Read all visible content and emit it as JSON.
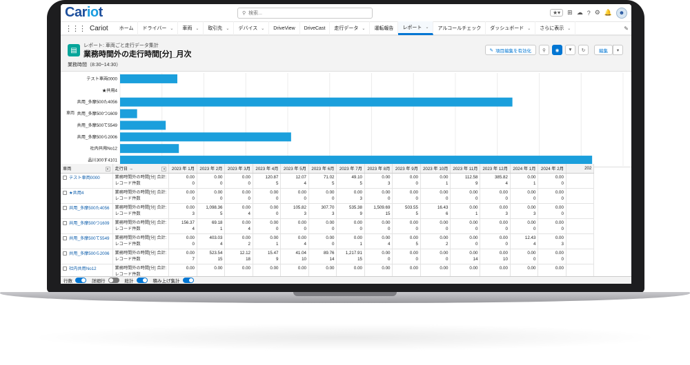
{
  "app": {
    "logo_prefix": "Car",
    "logo_o": "io",
    "logo_suffix": "t",
    "app_name": "Cariot",
    "search_placeholder": "検索..."
  },
  "nav": [
    {
      "label": "ホーム",
      "dropdown": false,
      "active": false
    },
    {
      "label": "ドライバー",
      "dropdown": true,
      "active": false
    },
    {
      "label": "車両",
      "dropdown": true,
      "active": false
    },
    {
      "label": "取引先",
      "dropdown": true,
      "active": false
    },
    {
      "label": "デバイス",
      "dropdown": true,
      "active": false
    },
    {
      "label": "DriveView",
      "dropdown": false,
      "active": false
    },
    {
      "label": "DriveCast",
      "dropdown": false,
      "active": false
    },
    {
      "label": "走行データ",
      "dropdown": true,
      "active": false
    },
    {
      "label": "運転報告",
      "dropdown": false,
      "active": false
    },
    {
      "label": "レポート",
      "dropdown": true,
      "active": true
    },
    {
      "label": "アルコールチェック",
      "dropdown": false,
      "active": false
    },
    {
      "label": "ダッシュボード",
      "dropdown": true,
      "active": false
    },
    {
      "label": "さらに表示",
      "dropdown": true,
      "active": false
    }
  ],
  "report": {
    "type": "レポート: 車両ごと走行データ集計",
    "title": "業務時間外の走行時間[分]_月次",
    "filter": "業務時間（8:30~14:30）",
    "enable_field_edit": "項目編集を有効化",
    "edit": "編集"
  },
  "colors": {
    "bar": "#1b9fdc",
    "accent": "#0176d3"
  },
  "chart_data": {
    "type": "bar",
    "orientation": "horizontal",
    "ylabel": "車両",
    "categories": [
      "テスト車両0000",
      "★共用4",
      "共用_多摩500た4056",
      "共用_多摩500つ1609",
      "共用_多摩500て5549",
      "共用_多摩500ら2006",
      "社内共用No12",
      "品川300す4101"
    ],
    "values": [
      74,
      0,
      507,
      22,
      59,
      221,
      76,
      610
    ],
    "xlim": [
      0,
      650
    ],
    "grid": true
  },
  "table": {
    "col_vehicle": "車両",
    "col_date": "走行日 →",
    "months": [
      "2023 年 1月",
      "2023 年 2月",
      "2023 年 3月",
      "2023 年 4月",
      "2023 年 5月",
      "2023 年 6月",
      "2023 年 7月",
      "2023 年 8月",
      "2023 年 9月",
      "2023 年 10月",
      "2023 年 11月",
      "2023 年 12月",
      "2024 年 1月",
      "2024 年 2月",
      "202"
    ],
    "measure_line1": "業務時間外の時間[分] 合計:",
    "measure_line2": "レコード件数",
    "rows": [
      {
        "vehicle": "テスト車両0000",
        "sums": [
          "0.00",
          "0.00",
          "0.00",
          "120.87",
          "12.07",
          "71.02",
          "49.10",
          "0.00",
          "0.00",
          "0.00",
          "112.58",
          "385.82",
          "0.00",
          "0.00"
        ],
        "counts": [
          "0",
          "0",
          "0",
          "5",
          "4",
          "5",
          "5",
          "3",
          "0",
          "1",
          "9",
          "4",
          "1",
          "0"
        ]
      },
      {
        "vehicle": "★共用4",
        "sums": [
          "0.00",
          "0.00",
          "0.00",
          "0.00",
          "0.00",
          "0.00",
          "0.00",
          "0.00",
          "0.00",
          "0.00",
          "0.00",
          "0.00",
          "0.00",
          "0.00"
        ],
        "counts": [
          "0",
          "0",
          "0",
          "0",
          "0",
          "0",
          "3",
          "0",
          "0",
          "0",
          "0",
          "0",
          "0",
          "0"
        ]
      },
      {
        "vehicle": "共用_多摩500た4056",
        "sums": [
          "0.00",
          "1,098.36",
          "0.00",
          "0.00",
          "105.82",
          "307.70",
          "535.38",
          "1,509.69",
          "503.55",
          "16.43",
          "0.00",
          "0.00",
          "0.00",
          "0.00"
        ],
        "counts": [
          "3",
          "5",
          "4",
          "0",
          "3",
          "3",
          "9",
          "15",
          "5",
          "6",
          "1",
          "3",
          "3",
          "0"
        ]
      },
      {
        "vehicle": "共用_多摩500つ1609",
        "sums": [
          "156.37",
          "69.18",
          "0.00",
          "0.00",
          "0.00",
          "0.00",
          "0.00",
          "0.00",
          "0.00",
          "0.00",
          "0.00",
          "0.00",
          "0.00",
          "0.00"
        ],
        "counts": [
          "4",
          "1",
          "4",
          "0",
          "0",
          "0",
          "0",
          "0",
          "0",
          "0",
          "0",
          "0",
          "0",
          "0"
        ]
      },
      {
        "vehicle": "共用_多摩500て5549",
        "sums": [
          "0.00",
          "403.03",
          "0.00",
          "0.00",
          "0.00",
          "0.00",
          "0.00",
          "0.00",
          "0.00",
          "0.00",
          "0.00",
          "0.00",
          "12.43",
          "0.00"
        ],
        "counts": [
          "0",
          "4",
          "2",
          "1",
          "4",
          "0",
          "1",
          "4",
          "5",
          "2",
          "0",
          "0",
          "4",
          "3"
        ]
      },
      {
        "vehicle": "共用_多摩500ら2006",
        "sums": [
          "0.00",
          "523.54",
          "12.12",
          "15.47",
          "41.04",
          "89.76",
          "1,217.91",
          "0.00",
          "0.00",
          "0.00",
          "0.00",
          "0.00",
          "0.00",
          "0.00"
        ],
        "counts": [
          "7",
          "15",
          "18",
          "9",
          "10",
          "14",
          "15",
          "0",
          "0",
          "0",
          "14",
          "10",
          "0",
          "0"
        ]
      },
      {
        "vehicle": "社内共用No12",
        "sums": [
          "0.00",
          "0.00",
          "0.00",
          "0.00",
          "0.00",
          "0.00",
          "0.00",
          "0.00",
          "0.00",
          "0.00",
          "0.00",
          "0.00",
          "0.00",
          "0.00"
        ],
        "counts": [
          "",
          "",
          "",
          "",
          "",
          "",
          "",
          "",
          "",
          "",
          "",
          "",
          "",
          ""
        ]
      }
    ]
  },
  "footer": {
    "row_count": "行数",
    "detail_rows": "詳細行",
    "subtotal": "総計",
    "stacked": "積み上げ集計"
  }
}
